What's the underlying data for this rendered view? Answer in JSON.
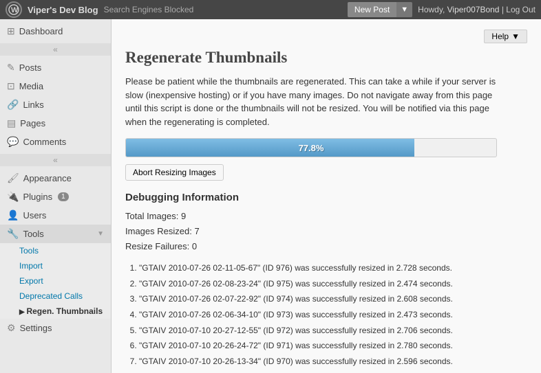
{
  "topbar": {
    "wp_logo": "W",
    "site_name": "Viper's Dev Blog",
    "search_blocked": "Search Engines Blocked",
    "new_post_label": "New Post",
    "dropdown_arrow": "▼",
    "howdy": "Howdy,",
    "user": "Viper007Bond",
    "separator": "|",
    "log_out": "Log Out",
    "help_label": "Help",
    "help_arrow": "▼"
  },
  "sidebar": {
    "dashboard_label": "Dashboard",
    "collapse1_arrow": "«",
    "posts_label": "Posts",
    "media_label": "Media",
    "links_label": "Links",
    "pages_label": "Pages",
    "comments_label": "Comments",
    "collapse2_arrow": "«",
    "appearance_label": "Appearance",
    "plugins_label": "Plugins",
    "plugins_badge": "1",
    "users_label": "Users",
    "tools_label": "Tools",
    "tools_arrow": "▼",
    "submenu": {
      "tools": "Tools",
      "import": "Import",
      "export": "Export",
      "deprecated": "Deprecated Calls",
      "regen": "Regen. Thumbnails"
    },
    "settings_label": "Settings"
  },
  "main": {
    "page_title": "Regenerate Thumbnails",
    "description": "Please be patient while the thumbnails are regenerated. This can take a while if your server is slow (inexpensive hosting) or if you have many images. Do not navigate away from this page until this script is done or the thumbnails will not be resized. You will be notified via this page when the regenerating is completed.",
    "progress_percent": "77.8%",
    "progress_value": 77.8,
    "abort_label": "Abort Resizing Images",
    "debug_title": "Debugging Information",
    "total_images_label": "Total Images:",
    "total_images_value": "9",
    "images_resized_label": "Images Resized:",
    "images_resized_value": "7",
    "resize_failures_label": "Resize Failures:",
    "resize_failures_value": "0",
    "resize_items": [
      "\"GTAIV 2010-07-26 02-11-05-67\" (ID 976) was successfully resized in 2.728 seconds.",
      "\"GTAIV 2010-07-26 02-08-23-24\" (ID 975) was successfully resized in 2.474 seconds.",
      "\"GTAIV 2010-07-26 02-07-22-92\" (ID 974) was successfully resized in 2.608 seconds.",
      "\"GTAIV 2010-07-26 02-06-34-10\" (ID 973) was successfully resized in 2.473 seconds.",
      "\"GTAIV 2010-07-10 20-27-12-55\" (ID 972) was successfully resized in 2.706 seconds.",
      "\"GTAIV 2010-07-10 20-26-24-72\" (ID 971) was successfully resized in 2.780 seconds.",
      "\"GTAIV 2010-07-10 20-26-13-34\" (ID 970) was successfully resized in 2.596 seconds."
    ]
  }
}
